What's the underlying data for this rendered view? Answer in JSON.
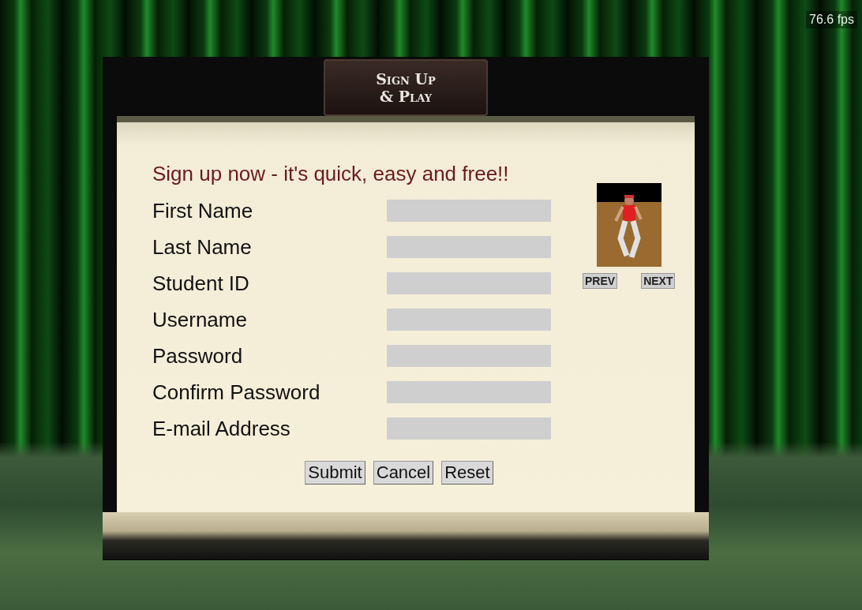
{
  "fps_counter": "76.6 fps",
  "title": {
    "line_1": "Sign Up",
    "line_2": "& Play"
  },
  "heading": "Sign up now - it's quick, easy and free!!",
  "fields": [
    {
      "label": "First Name"
    },
    {
      "label": "Last Name"
    },
    {
      "label": "Student ID"
    },
    {
      "label": "Username"
    },
    {
      "label": "Password"
    },
    {
      "label": "Confirm Password"
    },
    {
      "label": "E-mail Address"
    }
  ],
  "character_picker": {
    "prev": "PREV",
    "next": "NEXT"
  },
  "buttons": [
    "Submit",
    "Cancel",
    "Reset"
  ]
}
